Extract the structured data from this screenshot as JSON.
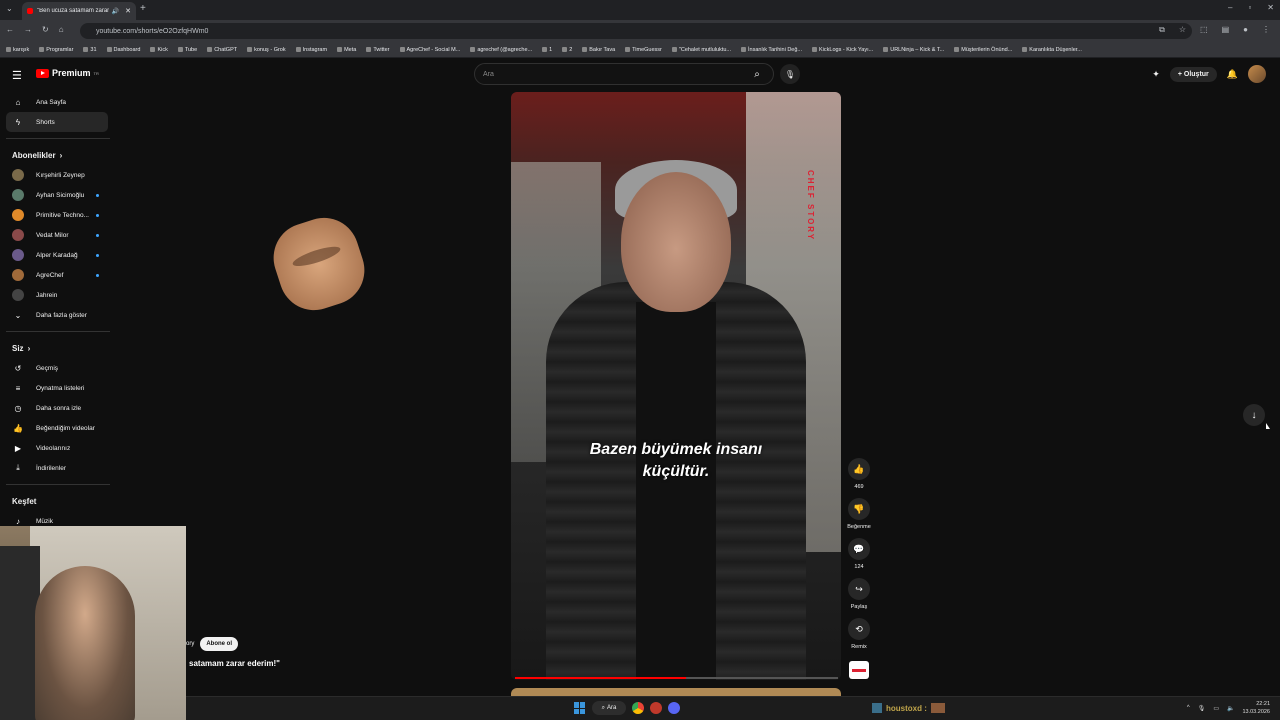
{
  "browser": {
    "tab_title": "\"Ben ucuza satamam zarar...",
    "url": "youtube.com/shorts/eO2OzfqHWm0",
    "bookmarks": [
      "karışık",
      "Programlar",
      "31",
      "Dashboard",
      "Kick",
      "Tube",
      "ChatGPT",
      "konuş - Grok",
      "Instagram",
      "Meta",
      "Twitter",
      "AgreChef - Social M...",
      "agrechef (@agreche...",
      "1",
      "2",
      "Bakır Tava",
      "TimeGuessr",
      "\"Cehalet mutluluktu...",
      "İnsanlık Tarihini Değ...",
      "KickLogs - Kick Yayı...",
      "URLNinja – Kick & T...",
      "Müşterilerin Önünd...",
      "Karanlıkta Düşenler..."
    ]
  },
  "header": {
    "logo_text": "Premium",
    "logo_region": "TR",
    "search_placeholder": "Ara",
    "create_label": "Oluştur"
  },
  "sidebar": {
    "main": [
      {
        "label": "Ana Sayfa",
        "icon": "home-icon"
      },
      {
        "label": "Shorts",
        "icon": "shorts-icon"
      }
    ],
    "subs_heading": "Abonelikler",
    "subscriptions": [
      {
        "label": "Kırşehirli Zeynep",
        "color": "#7a6a4a",
        "dot": false
      },
      {
        "label": "Ayhan Sicimoğlu",
        "color": "#5a7a6a",
        "dot": true
      },
      {
        "label": "Primitive Techno...",
        "color": "#e08a2a",
        "dot": true
      },
      {
        "label": "Vedat Milor",
        "color": "#8a4a4a",
        "dot": true
      },
      {
        "label": "Alper Karadağ",
        "color": "#6a5a8a",
        "dot": true
      },
      {
        "label": "AgreChef",
        "color": "#a06a3a",
        "dot": true
      },
      {
        "label": "Jahrein",
        "color": "#444444",
        "dot": false
      }
    ],
    "show_more": "Daha fazla göster",
    "you_heading": "Siz",
    "you_items": [
      {
        "label": "Geçmiş",
        "icon": "history-icon"
      },
      {
        "label": "Oynatma listeleri",
        "icon": "playlist-icon"
      },
      {
        "label": "Daha sonra izle",
        "icon": "clock-icon"
      },
      {
        "label": "Beğendiğim videolar",
        "icon": "like-icon"
      },
      {
        "label": "Videolarınız",
        "icon": "video-icon"
      },
      {
        "label": "İndirilenler",
        "icon": "download-icon"
      }
    ],
    "explore_heading": "Keşfet",
    "explore_items": [
      {
        "label": "Müzik",
        "icon": "music-icon"
      }
    ]
  },
  "video": {
    "caption_line1": "Bazen büyümek insanı",
    "caption_line2": "küçültür.",
    "watermark": "CHEF STORY",
    "progress_fraction": 0.53,
    "channel_fragment": "ory",
    "subscribe_label": "Abone ol",
    "title_fragment": "satamam zarar ederim!\""
  },
  "actions": {
    "likes": "469",
    "dislike_label": "Beğenme",
    "comments": "124",
    "share_label": "Paylaş",
    "remix_label": "Remix"
  },
  "taskbar": {
    "search_label": "Ara",
    "user_label": "houstoxd :",
    "time": "22:21",
    "date": "13.03.2026"
  }
}
